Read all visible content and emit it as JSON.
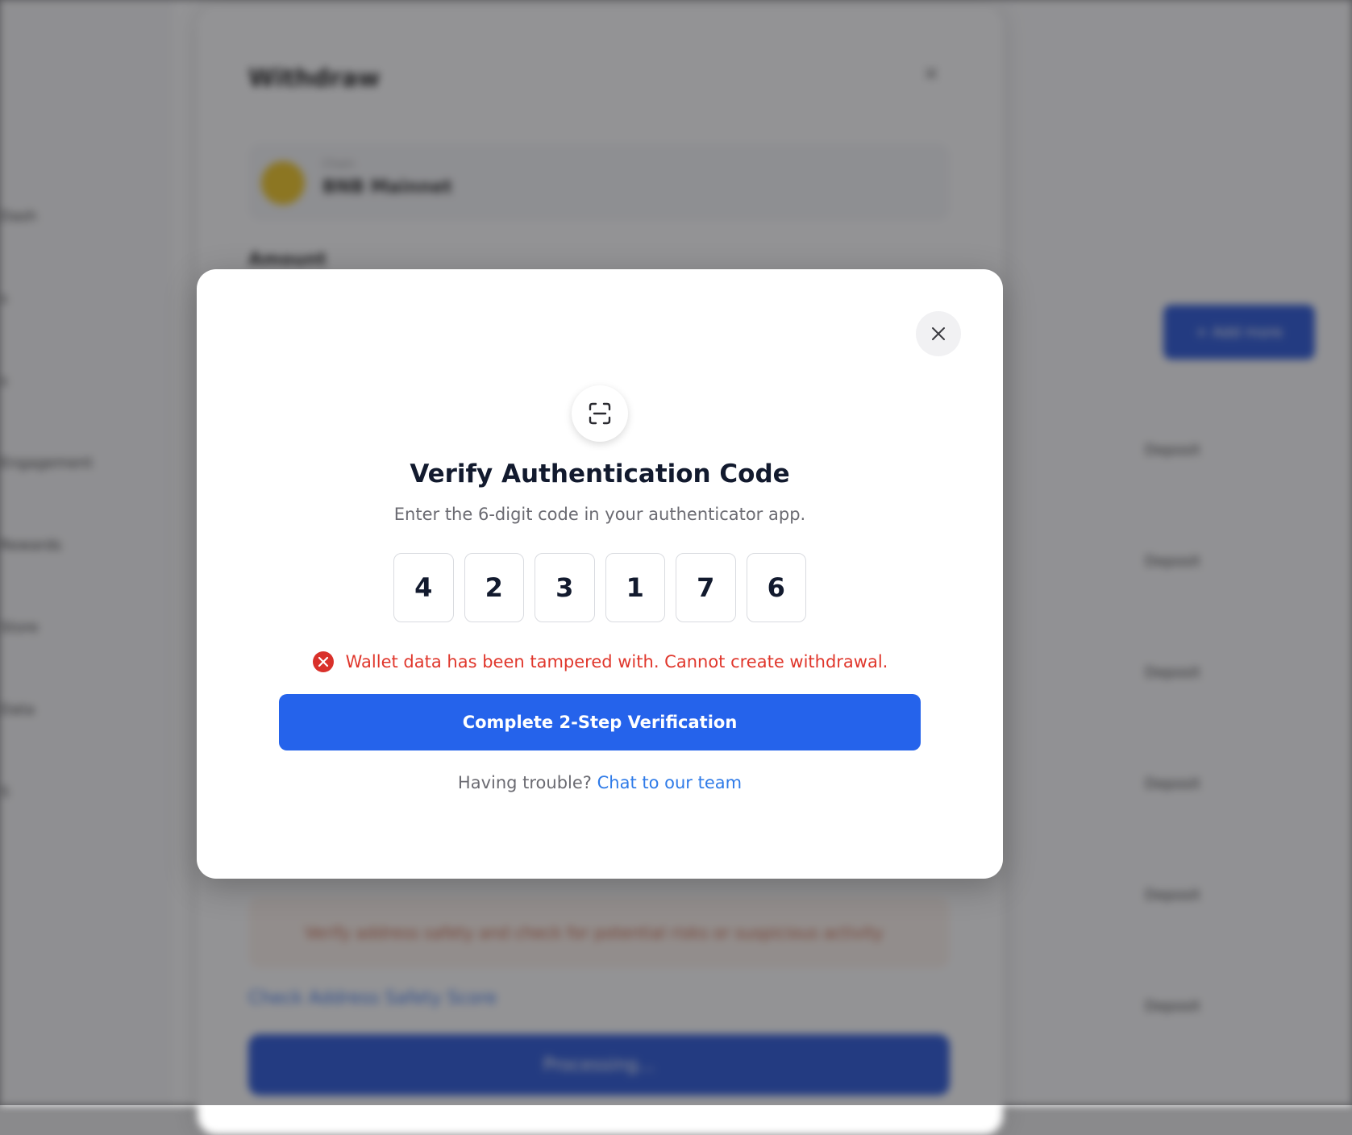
{
  "background": {
    "sidebar_items": [
      "Dash",
      "s",
      "s",
      "Engagement",
      "Rewards",
      "Store",
      "Data",
      "S"
    ],
    "withdraw": {
      "title": "Withdraw",
      "chain_label": "Chain",
      "chain_name": "BNB Mainnet",
      "amount_label": "Amount",
      "warning": "Verify address safety and check for potential risks or suspicious activity",
      "check_link": "Check Address Safety Score",
      "processing_label": "Processing..."
    },
    "add_button_label": "+ Add more",
    "right_rows": [
      "Deposit",
      "Deposit",
      "Deposit",
      "Deposit",
      "Deposit",
      "Deposit"
    ]
  },
  "modal": {
    "title": "Verify Authentication Code",
    "subtitle": "Enter the 6-digit code in your authenticator app.",
    "code_digits": [
      "4",
      "2",
      "3",
      "1",
      "7",
      "6"
    ],
    "error": "Wallet data has been tampered with. Cannot create withdrawal.",
    "verify_button": "Complete 2-Step Verification",
    "help_prefix": "Having trouble?",
    "help_link": "Chat to our team"
  },
  "colors": {
    "primary": "#2563eb",
    "error": "#e0372c",
    "link": "#2f7be8",
    "title": "#121a2e"
  },
  "icons": {
    "close": "close-icon",
    "scan": "scan-icon",
    "error": "error-circle-icon"
  }
}
